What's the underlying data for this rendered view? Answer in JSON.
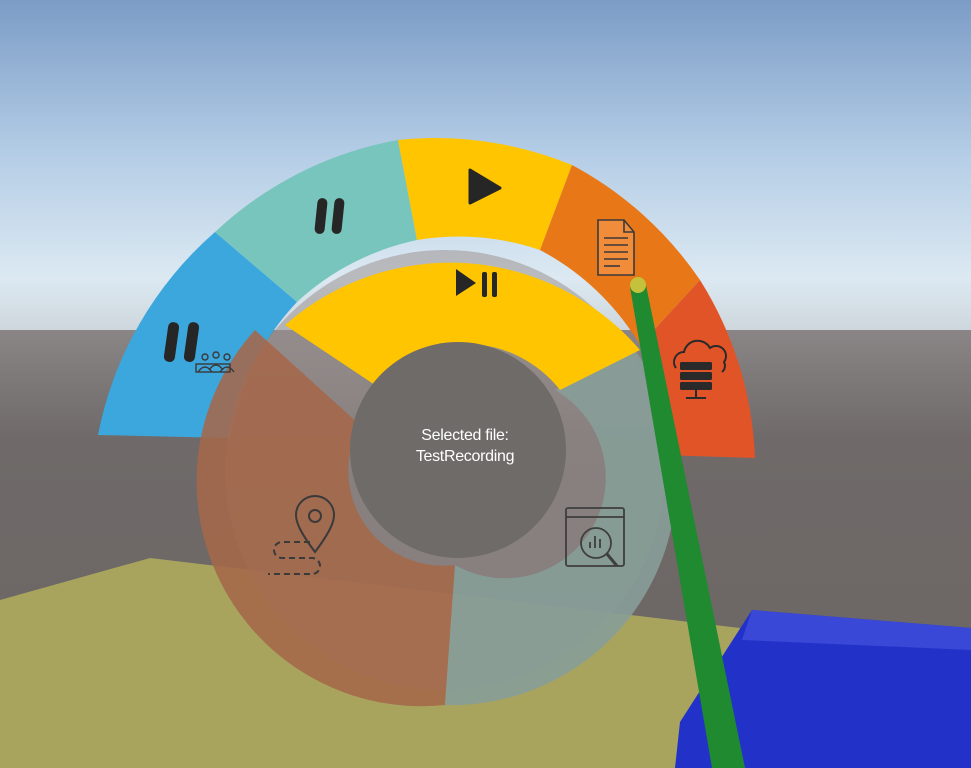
{
  "center": {
    "line1": "Selected file:",
    "line2": "TestRecording"
  },
  "colors": {
    "sky_top": "#7e9ec8",
    "sky_horizon": "#dde9f2",
    "ground_far": "#6e6866",
    "floor": "#a7a35c",
    "blue_box": "#2131c4",
    "pointer": "#1f8a30",
    "pointer_tip": "#c3c03a",
    "segment_blue": "#3aa6dc",
    "segment_teal": "#76c4bc",
    "segment_yellow": "#ffc500",
    "segment_orange": "#e8761a",
    "segment_red": "#e05428",
    "inner_brown": "#a06848",
    "inner_gray": "#869c98",
    "hub": "#6e6a68"
  },
  "menu": {
    "outer_ring": [
      {
        "id": "pause-collab",
        "icon": "pause-collaboration-icon"
      },
      {
        "id": "pause",
        "icon": "pause-icon"
      },
      {
        "id": "play",
        "icon": "play-icon"
      },
      {
        "id": "file",
        "icon": "file-document-icon"
      },
      {
        "id": "cloud-server",
        "icon": "cloud-server-icon"
      }
    ],
    "inner_ring": [
      {
        "id": "play-pause",
        "icon": "play-pause-icon"
      },
      {
        "id": "analytics",
        "icon": "analytics-icon"
      },
      {
        "id": "location-path",
        "icon": "location-path-icon"
      }
    ]
  }
}
